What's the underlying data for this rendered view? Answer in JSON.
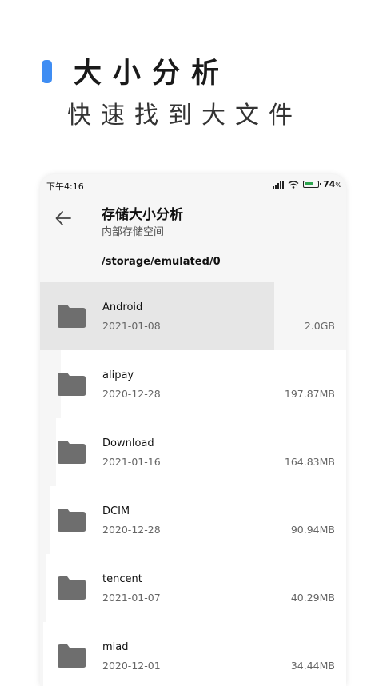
{
  "promo": {
    "title": "大小分析",
    "subtitle": "快速找到大文件",
    "accent_color": "#3f8df3"
  },
  "statusbar": {
    "time": "下午4:16",
    "battery": "74",
    "battery_unit": "%"
  },
  "header": {
    "title": "存储大小分析",
    "subtitle": "内部存储空间"
  },
  "path": "/storage/emulated/0",
  "items": [
    {
      "name": "Android",
      "date": "2021-01-08",
      "size": "2.0GB",
      "selected": true
    },
    {
      "name": "alipay",
      "date": "2020-12-28",
      "size": "197.87MB"
    },
    {
      "name": "Download",
      "date": "2021-01-16",
      "size": "164.83MB"
    },
    {
      "name": "DCIM",
      "date": "2020-12-28",
      "size": "90.94MB"
    },
    {
      "name": "tencent",
      "date": "2021-01-07",
      "size": "40.29MB"
    },
    {
      "name": "miad",
      "date": "2020-12-01",
      "size": "34.44MB"
    }
  ]
}
